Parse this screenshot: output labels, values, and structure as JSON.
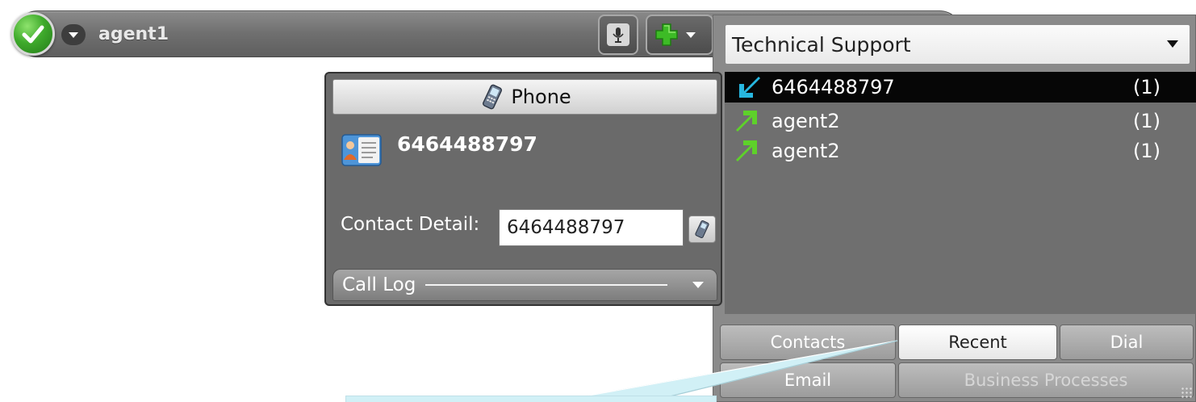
{
  "agent_bar": {
    "status_icon": "checkmark-icon",
    "status_color": "#3faa2c",
    "agent_name": "agent1",
    "mic_icon": "microphone-icon",
    "add_icon": "plus-icon",
    "add_color": "#3dbb26"
  },
  "queue": {
    "selected_queue": "Technical Support",
    "items": [
      {
        "direction_icon": "inbound-arrow-icon",
        "label": "6464488797",
        "count": "(1)",
        "selected": true
      },
      {
        "direction_icon": "outbound-arrow-icon",
        "label": "agent2",
        "count": "(1)",
        "selected": false
      },
      {
        "direction_icon": "outbound-arrow-icon",
        "label": "agent2",
        "count": "(1)",
        "selected": false
      }
    ]
  },
  "tabs": {
    "row1": [
      "Contacts",
      "Recent",
      "Dial"
    ],
    "row2": [
      "Email",
      "Business Processes"
    ],
    "active": "Recent"
  },
  "interaction": {
    "header_label": "Phone",
    "header_icon": "mobile-phone-icon",
    "contact_number": "6464488797",
    "contact_detail_label": "Contact Detail:",
    "contact_detail_value": "6464488797",
    "call_log_label": "Call Log"
  },
  "colors": {
    "panel_bg": "#6a6a6a",
    "selected_row": "#060606",
    "inbound_arrow": "#27b7e0",
    "outbound_arrow": "#5ed12a",
    "callout": "#d1f0f6"
  }
}
